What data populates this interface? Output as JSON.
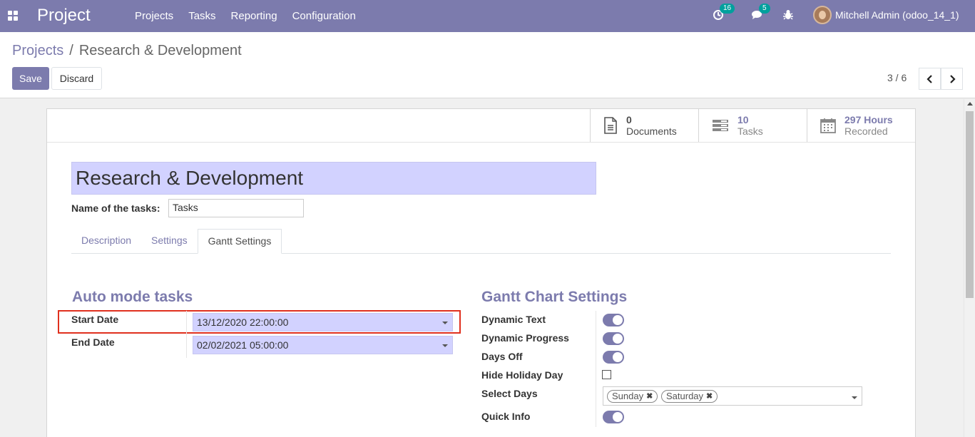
{
  "navbar": {
    "brand": "Project",
    "menu": [
      "Projects",
      "Tasks",
      "Reporting",
      "Configuration"
    ],
    "activity_badge": "16",
    "messages_badge": "5",
    "user_name": "Mitchell Admin (odoo_14_1)"
  },
  "control": {
    "breadcrumb_parent": "Projects",
    "breadcrumb_separator": "/",
    "breadcrumb_current": "Research & Development",
    "save_label": "Save",
    "discard_label": "Discard",
    "pager_value": "3 / 6"
  },
  "stat_buttons": [
    {
      "value": "0",
      "label": "Documents",
      "icon": "document-icon"
    },
    {
      "value": "10",
      "label": "Tasks",
      "icon": "tasks-icon"
    },
    {
      "value": "297 Hours",
      "label": "Recorded",
      "icon": "calendar-icon"
    }
  ],
  "form": {
    "title": "Research & Development",
    "name_of_tasks_label": "Name of the tasks:",
    "name_of_tasks_value": "Tasks"
  },
  "tabs": [
    {
      "label": "Description",
      "active": false
    },
    {
      "label": "Settings",
      "active": false
    },
    {
      "label": "Gantt Settings",
      "active": true
    }
  ],
  "auto_mode": {
    "title": "Auto mode tasks",
    "start_date_label": "Start Date",
    "start_date_value": "13/12/2020 22:00:00",
    "end_date_label": "End Date",
    "end_date_value": "02/02/2021 05:00:00"
  },
  "gantt_settings": {
    "title": "Gantt Chart Settings",
    "dynamic_text_label": "Dynamic Text",
    "dynamic_text": true,
    "dynamic_progress_label": "Dynamic Progress",
    "dynamic_progress": true,
    "days_off_label": "Days Off",
    "days_off": true,
    "hide_holiday_day_label": "Hide Holiday Day",
    "hide_holiday_day": false,
    "select_days_label": "Select Days",
    "select_days": [
      "Sunday",
      "Saturday"
    ],
    "quick_info_label": "Quick Info",
    "quick_info": true
  },
  "colors": {
    "brand": "#7c7bad",
    "field_required_bg": "#d2d2ff",
    "badge": "#00a09d",
    "highlight": "#e0301e"
  }
}
